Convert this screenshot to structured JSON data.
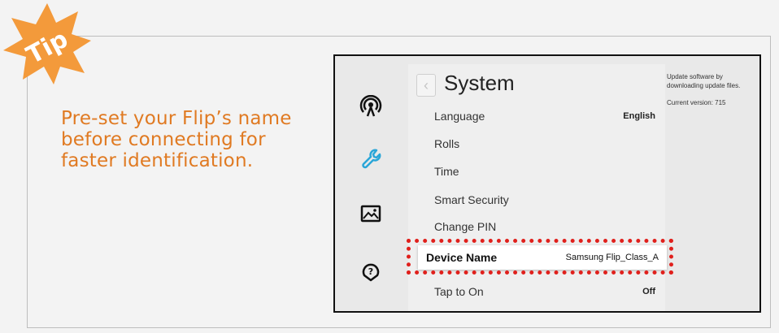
{
  "badge": {
    "label": "Tip",
    "color": "#f39a3b"
  },
  "tip_text": "Pre-set your Flip’s name before connecting for faster identification.",
  "accent_color": "#e07a22",
  "highlight_color": "#e0201c",
  "rail_icons": [
    "broadcast-icon",
    "wrench-icon",
    "picture-icon",
    "support-icon"
  ],
  "menu": {
    "title": "System",
    "items": [
      {
        "label": "Language",
        "value": "English"
      },
      {
        "label": "Rolls",
        "value": ""
      },
      {
        "label": "Time",
        "value": ""
      },
      {
        "label": "Smart Security",
        "value": ""
      },
      {
        "label": "Change PIN",
        "value": ""
      },
      {
        "label": "Device Name",
        "value": "Samsung Flip_Class_A"
      },
      {
        "label": "Tap to On",
        "value": "Off"
      }
    ]
  },
  "side_panel": {
    "description": "Update software by downloading update files.",
    "version": "Current version: 715"
  }
}
